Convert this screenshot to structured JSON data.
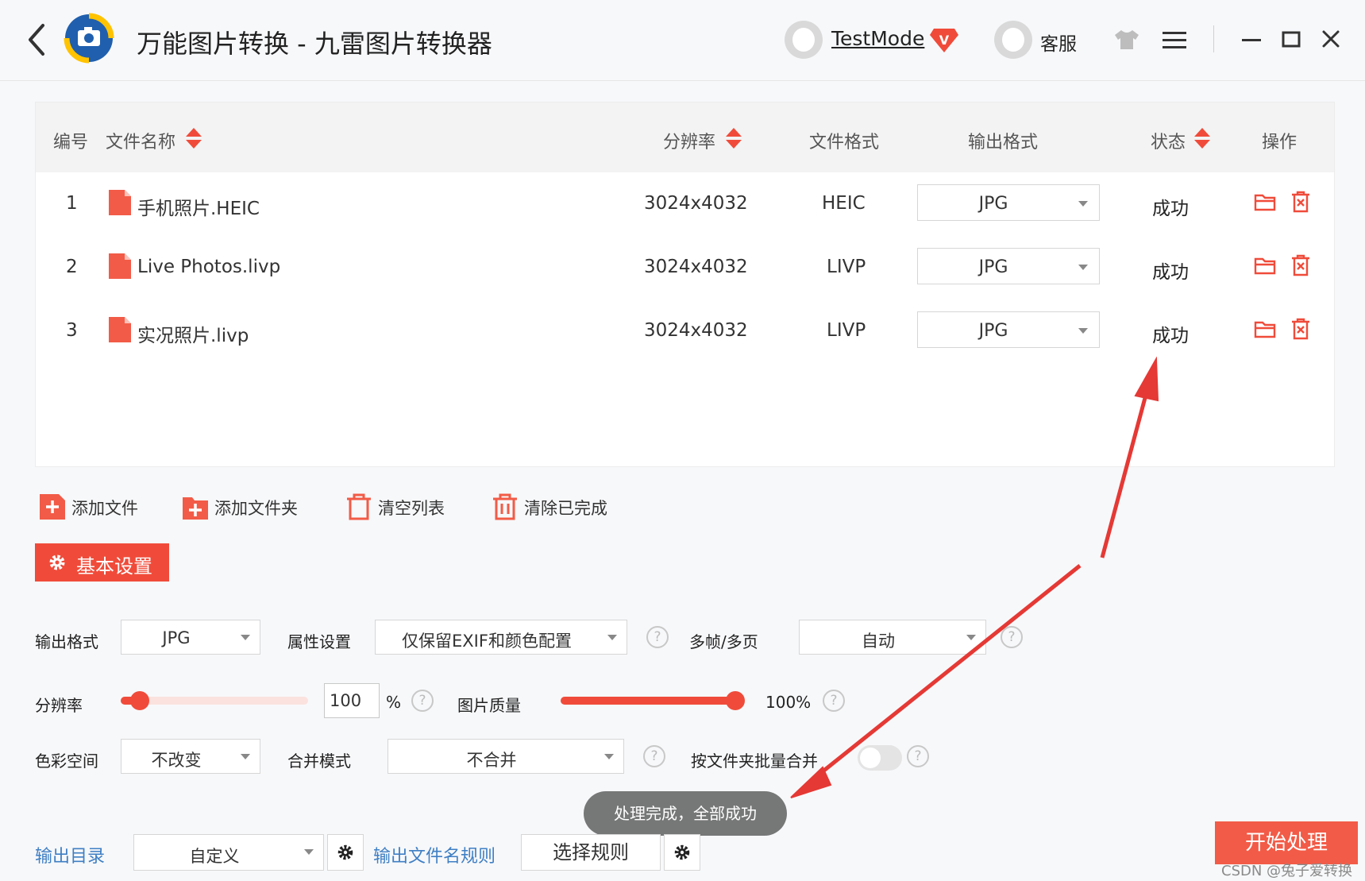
{
  "titlebar": {
    "title": "万能图片转换 - 九雷图片转换器",
    "username": "TestMode",
    "vip_badge": "V",
    "service_label": "客服"
  },
  "table": {
    "headers": {
      "index": "编号",
      "filename": "文件名称",
      "resolution": "分辨率",
      "file_format": "文件格式",
      "output_format": "输出格式",
      "status": "状态",
      "actions": "操作"
    },
    "rows": [
      {
        "index": "1",
        "filename": "手机照片.HEIC",
        "resolution": "3024x4032",
        "file_format": "HEIC",
        "output_format": "JPG",
        "status": "成功"
      },
      {
        "index": "2",
        "filename": "Live Photos.livp",
        "resolution": "3024x4032",
        "file_format": "LIVP",
        "output_format": "JPG",
        "status": "成功"
      },
      {
        "index": "3",
        "filename": "实况照片.livp",
        "resolution": "3024x4032",
        "file_format": "LIVP",
        "output_format": "JPG",
        "status": "成功"
      }
    ]
  },
  "toolbar": {
    "add_file": "添加文件",
    "add_folder": "添加文件夹",
    "clear_list": "清空列表",
    "clear_done": "清除已完成"
  },
  "settings": {
    "tab_label": "基本设置",
    "output_format_label": "输出格式",
    "output_format_value": "JPG",
    "attribute_label": "属性设置",
    "attribute_value": "仅保留EXIF和颜色配置",
    "multiframe_label": "多帧/多页",
    "multiframe_value": "自动",
    "resolution_label": "分辨率",
    "resolution_value": "100",
    "resolution_percent": 0.1,
    "resolution_unit": "%",
    "quality_label": "图片质量",
    "quality_value": "100%",
    "quality_percent": 1.0,
    "colorspace_label": "色彩空间",
    "colorspace_value": "不改变",
    "merge_label": "合并模式",
    "merge_value": "不合并",
    "batch_merge_label": "按文件夹批量合并",
    "batch_merge_enabled": false,
    "help_glyph": "?"
  },
  "output": {
    "dir_label": "输出目录",
    "dir_value": "自定义",
    "name_rule_label": "输出文件名规则",
    "rule_button": "选择规则"
  },
  "toast": "处理完成，全部成功",
  "start_button": "开始处理",
  "watermark": "CSDN @兔子爱转换",
  "colors": {
    "accent": "#f04b3a",
    "link": "#3f7fc4",
    "annotation_arrow": "#e53935"
  }
}
